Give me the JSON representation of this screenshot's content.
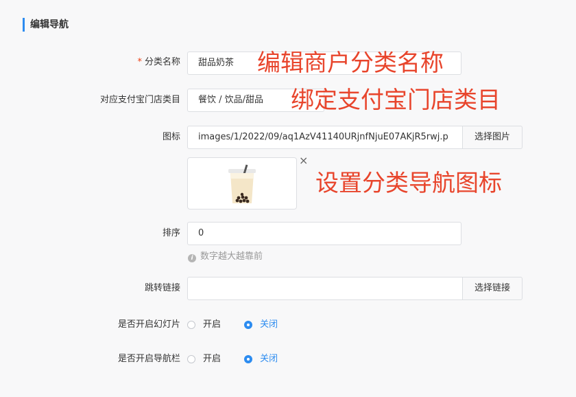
{
  "section_title": "编辑导航",
  "fields": {
    "name": {
      "label": "分类名称",
      "required_mark": "*",
      "value": "甜品奶茶"
    },
    "category": {
      "label": "对应支付宝门店类目",
      "value": "餐饮 / 饮品/甜品"
    },
    "icon": {
      "label": "图标",
      "value": "images/1/2022/09/aq1AzV41140URjnfNjuE07AKjR5rwj.p",
      "button": "选择图片",
      "remove": "×"
    },
    "sort": {
      "label": "排序",
      "value": "0",
      "hint": "数字越大越靠前",
      "hint_icon": "i"
    },
    "link": {
      "label": "跳转链接",
      "value": "",
      "button": "选择链接"
    },
    "slideshow": {
      "label": "是否开启幻灯片",
      "options": [
        "开启",
        "关闭"
      ],
      "selected": "关闭"
    },
    "navbar": {
      "label": "是否开启导航栏",
      "options": [
        "开启",
        "关闭"
      ],
      "selected": "关闭"
    }
  },
  "annotations": {
    "name": "编辑商户分类名称",
    "category": "绑定支付宝门店类目",
    "icon": "设置分类导航图标"
  },
  "colors": {
    "accent": "#2d8cf0",
    "annotation": "#e8452c",
    "required": "#ed4014"
  }
}
